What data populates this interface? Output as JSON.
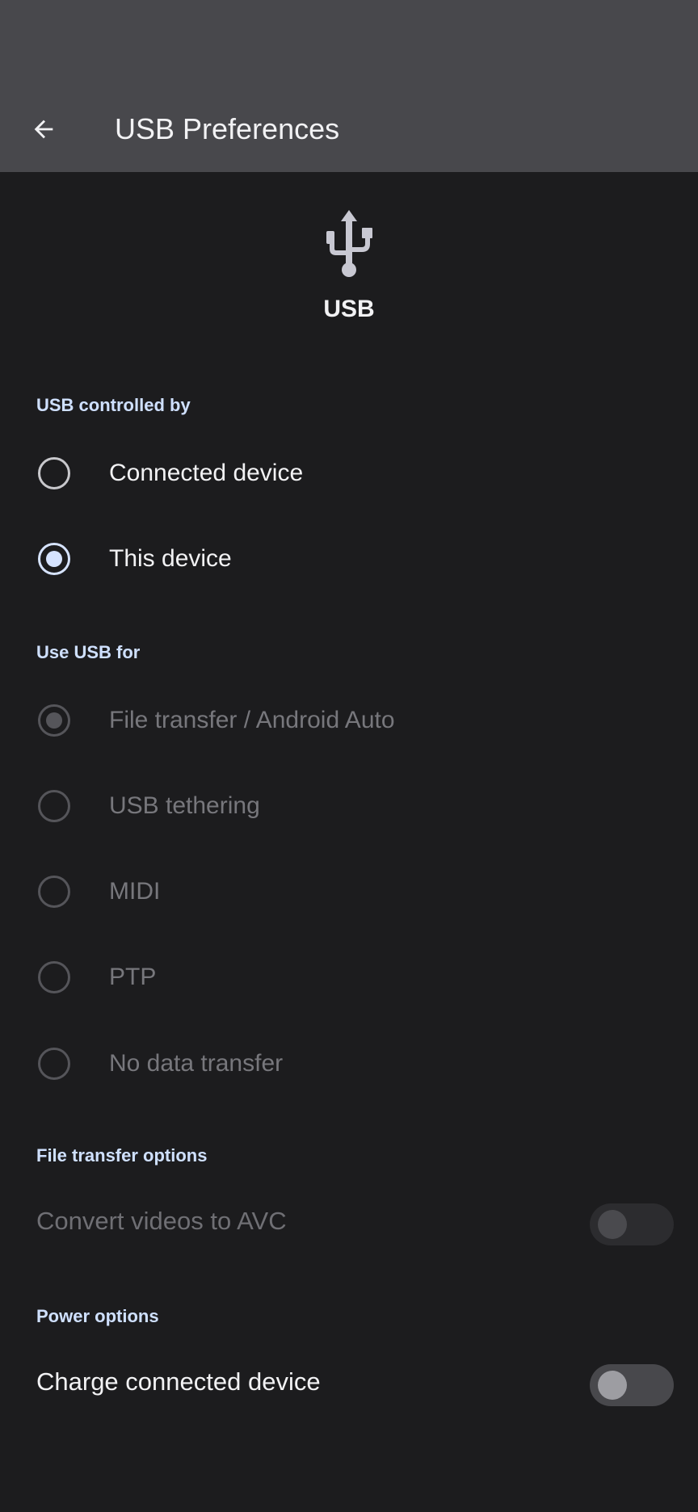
{
  "appbar": {
    "title": "USB Preferences",
    "back_icon": "arrow-back-icon"
  },
  "hero": {
    "icon": "usb-icon",
    "label": "USB"
  },
  "controlled_by": {
    "header": "USB controlled by",
    "options": [
      {
        "label": "Connected device",
        "selected": false
      },
      {
        "label": "This device",
        "selected": true
      }
    ]
  },
  "use_usb_for": {
    "header": "Use USB for",
    "options": [
      {
        "label": "File transfer / Android Auto",
        "selected": true
      },
      {
        "label": "USB tethering",
        "selected": false
      },
      {
        "label": "MIDI",
        "selected": false
      },
      {
        "label": "PTP",
        "selected": false
      },
      {
        "label": "No data transfer",
        "selected": false
      }
    ]
  },
  "file_transfer_options": {
    "header": "File transfer options",
    "convert_avc": {
      "label": "Convert videos to AVC",
      "on": false,
      "enabled": false
    }
  },
  "power_options": {
    "header": "Power options",
    "charge": {
      "label": "Charge connected device",
      "on": false,
      "enabled": true
    }
  },
  "colors": {
    "accent": "#d6e3ff",
    "appbar": "#48484c",
    "background": "#1c1c1e"
  }
}
